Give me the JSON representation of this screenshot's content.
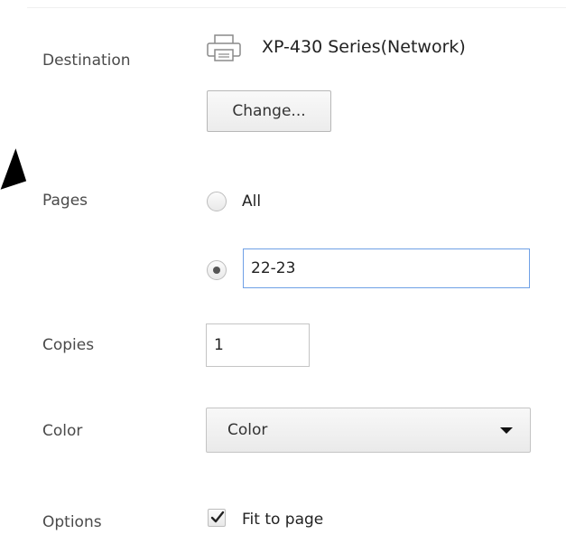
{
  "destination": {
    "label": "Destination",
    "printer_name": "XP-430 Series(Network)",
    "change_button": "Change..."
  },
  "pages": {
    "label": "Pages",
    "option_all": "All",
    "custom_value": "22-23",
    "selected": "custom"
  },
  "copies": {
    "label": "Copies",
    "value": "1"
  },
  "color": {
    "label": "Color",
    "selected": "Color"
  },
  "options": {
    "label": "Options",
    "fit_to_page_label": "Fit to page",
    "fit_to_page_checked": true
  },
  "icons": {
    "printer": "printer-icon",
    "dropdown": "chevron-down-icon",
    "check": "check-icon",
    "pointer": "cursor-arrow-icon"
  }
}
